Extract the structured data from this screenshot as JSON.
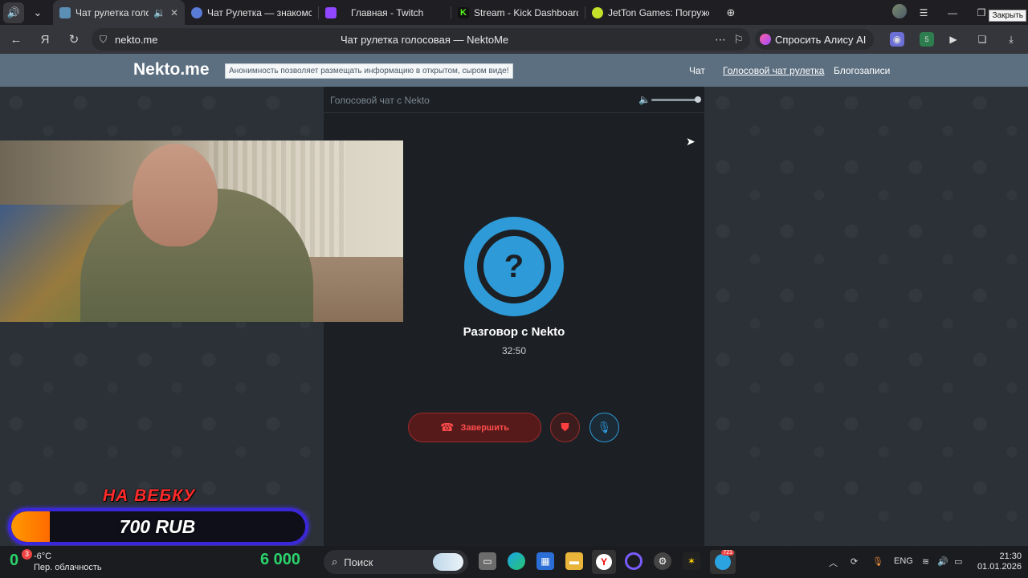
{
  "browser": {
    "tabs": [
      {
        "title": "Чат рулетка голосов",
        "active": true,
        "muted_icon": "speaker-icon"
      },
      {
        "title": "Чат Рулетка — знакомств",
        "active": false
      },
      {
        "title": "Главная - Twitch",
        "active": false
      },
      {
        "title": "Stream - Kick Dashboard",
        "active": false
      },
      {
        "title": "JetTon Games: Погружен",
        "active": false
      }
    ],
    "close_tooltip": "Закрыть",
    "url_host": "nekto.me",
    "page_title": "Чат рулетка голосовая — NektoMe",
    "alice_label": "Спросить Алису AI",
    "ext_badge": "5"
  },
  "site": {
    "logo": "Nekto.me",
    "motto": "Анонимность позволяет размещать информацию в открытом, сыром виде!",
    "menu": [
      {
        "label": "Чат",
        "underlined": false
      },
      {
        "label": "Голосовой чат рулетка",
        "underlined": true
      },
      {
        "label": "Блогозаписи",
        "underlined": false
      }
    ]
  },
  "chat_panel": {
    "title": "Голосовой чат с Nekto",
    "volume_level": 1.0,
    "avatar_glyph": "?",
    "talk_title": "Разговор с Nekto",
    "talk_time": "32:50",
    "end_button": "Завершить"
  },
  "overlay": {
    "label": "НА ВЕБКУ",
    "amount": "700 RUB",
    "progress": 0.13
  },
  "taskbar": {
    "weather_value": "0",
    "weather_badge": "3",
    "temperature": "-6°C",
    "weather_desc": "Пер. облачность",
    "counter": "6 000",
    "search_placeholder": "Поиск",
    "telegram_badge": "721",
    "lang": "ENG",
    "time": "21:30",
    "date": "01.01.2026"
  },
  "colors": {
    "accent": "#2e9ad8",
    "danger": "#ff4c4c",
    "header": "#5c6f80",
    "panel": "#1c2024"
  }
}
